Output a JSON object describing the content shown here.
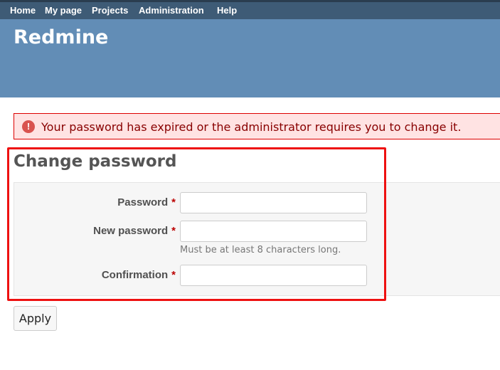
{
  "top_menu": {
    "items": [
      {
        "label": "Home"
      },
      {
        "label": "My page"
      },
      {
        "label": "Projects"
      },
      {
        "label": "Administration"
      },
      {
        "label": "Help"
      }
    ]
  },
  "header": {
    "title": "Redmine"
  },
  "flash": {
    "message": "Your password has expired or the administrator requires you to change it.",
    "icon": "error-icon",
    "icon_glyph": "!",
    "color": "#880000"
  },
  "page": {
    "title": "Change password"
  },
  "form": {
    "required_marker": "*",
    "password": {
      "label": "Password",
      "value": ""
    },
    "new_password": {
      "label": "New password",
      "value": "",
      "hint": "Must be at least 8 characters long."
    },
    "confirmation": {
      "label": "Confirmation",
      "value": ""
    },
    "submit_label": "Apply"
  },
  "colors": {
    "top_menu_bg": "#3e5b76",
    "header_bg": "#628db6",
    "flash_bg": "#ffe3e3",
    "highlight": "#ee1111"
  }
}
